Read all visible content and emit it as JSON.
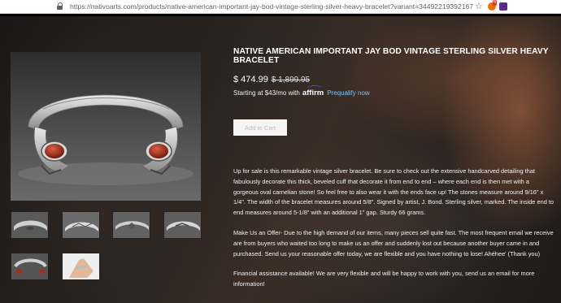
{
  "browser": {
    "url": "https://nativoarts.com/products/native-american-important-jay-bod-vintage-sterling-silver-heavy-bracelet?variant=34492219392167",
    "extension_badge": "6"
  },
  "product": {
    "title": "NATIVE AMERICAN IMPORTANT JAY BOD VINTAGE STERLING SILVER HEAVY BRACELET",
    "price": "$ 474.99",
    "compare_price": "$ 1,899.95",
    "financing_prefix": "Starting at $43/mo with",
    "financing_brand": "affirm",
    "prequalify_link": "Prequalify now",
    "add_to_cart_label": "Add to Cart",
    "description": [
      "Up for sale is this remarkable vintage silver bracelet. Be sure to check out the extensive handcarved detailing that fabulously decorate this thick, beveled cuff that decorate it from end to end – where each end is then met with a gorgeous oval carnelian stone! So feel free to also wear it with the ends face up! The stones measure around 9/16\" x 1/4\". The width of the bracelet measures around 5/8\". Signed by artist, J. Bond. Sterling silver, marked. The inside end to end measures around 5-1/8\" with an additional 1\" gap. Sturdy 66 grams.",
      "Make Us an Offer- Due to the high demand of our items, many pieces sell quite fast. The most frequent email we receive are from buyers who waited too long to make us an offer and suddenly lost out because another buyer came in and purchased. Send us your reasonable offer today, we are flexible and you have nothing to lose! Ahéhee' (Thank you)",
      "Financial assistance available! We are very flexible and will be happy to work with you, send us an email for more information!"
    ]
  },
  "gallery": {
    "main_image": "silver-cuff-bracelet-carnelian-ends",
    "thumbnails": [
      "bracelet-front-view",
      "bracelet-side-view",
      "bracelet-top-view",
      "bracelet-alt-view",
      "bracelet-carnelian-view",
      "bracelet-on-wrist"
    ]
  },
  "colors": {
    "page_bg": "#1c1a19",
    "text": "#ffffff",
    "link": "#7fc4f5",
    "carnelian": "#9c3320",
    "silver": "#c9c9c9"
  }
}
